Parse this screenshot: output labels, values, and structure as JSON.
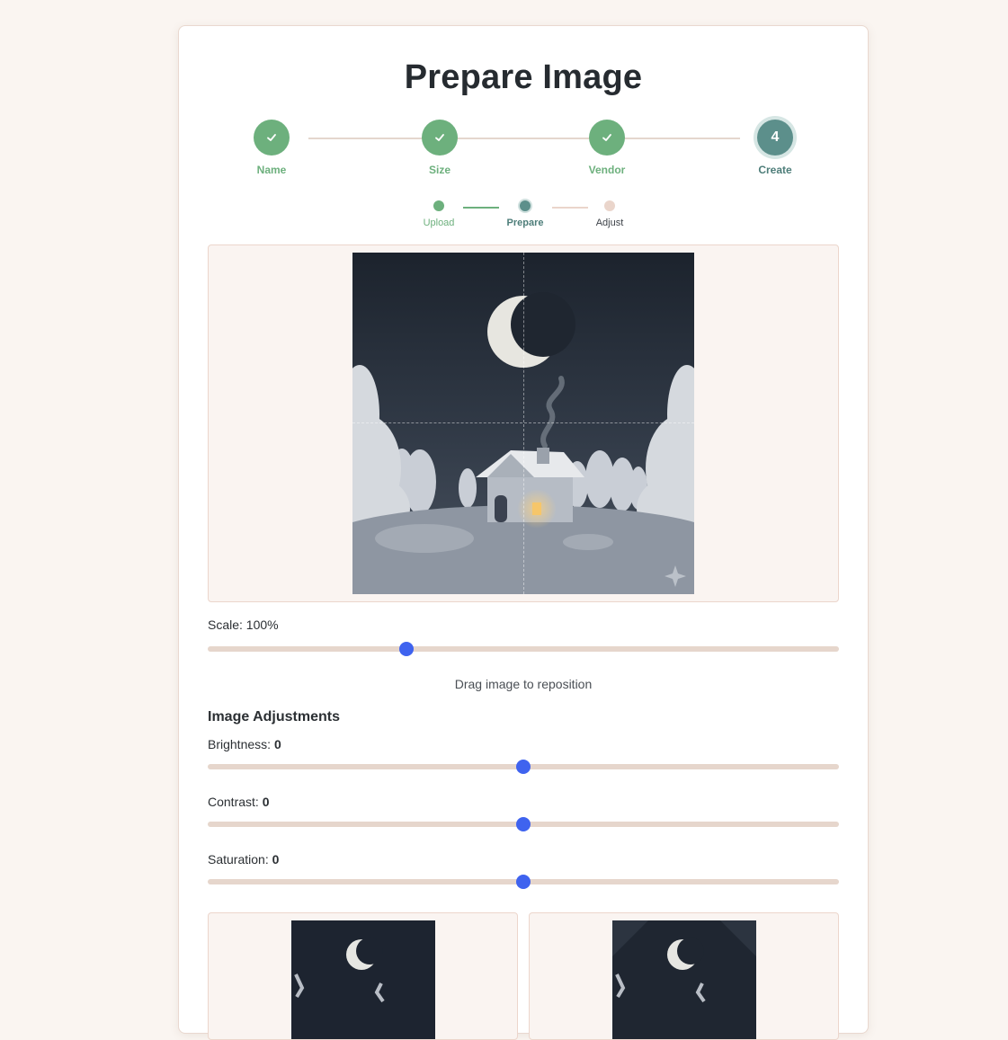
{
  "title": "Prepare Image",
  "steps": [
    {
      "label": "Name",
      "state": "done"
    },
    {
      "label": "Size",
      "state": "done"
    },
    {
      "label": "Vendor",
      "state": "done"
    },
    {
      "label": "Create",
      "number": "4",
      "state": "active"
    }
  ],
  "substeps": [
    {
      "label": "Upload",
      "state": "done"
    },
    {
      "label": "Prepare",
      "state": "active"
    },
    {
      "label": "Adjust",
      "state": "todo"
    }
  ],
  "scale": {
    "label": "Scale: 100%",
    "value_fraction": 0.315
  },
  "hint": "Drag image to reposition",
  "adjustments": {
    "title": "Image Adjustments",
    "brightness": {
      "label": "Brightness:",
      "value": "0",
      "value_fraction": 0.5
    },
    "contrast": {
      "label": "Contrast:",
      "value": "0",
      "value_fraction": 0.5
    },
    "saturation": {
      "label": "Saturation:",
      "value": "0",
      "value_fraction": 0.5
    }
  },
  "colors": {
    "accent": "#3f63ef",
    "done": "#6db07d",
    "active": "#5c8f8b",
    "todo": "#ead5cb"
  },
  "icons": {
    "check": "check-icon",
    "sparkle": "sparkle-icon"
  }
}
